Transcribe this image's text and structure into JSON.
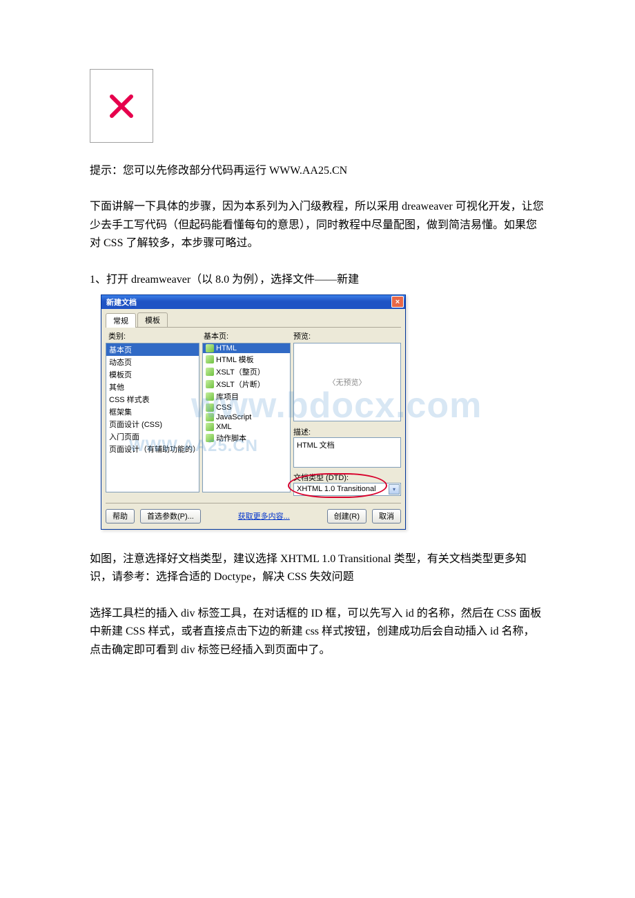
{
  "tip_text": "提示：您可以先修改部分代码再运行 WWW.AA25.CN",
  "intro_text": "下面讲解一下具体的步骤，因为本系列为入门级教程，所以采用 dreaweaver 可视化开发，让您少去手工写代码（但起码能看懂每句的意思），同时教程中尽量配图，做到简洁易懂。如果您对 CSS 了解较多，本步骤可略过。",
  "step1_text": "1、打开 dreamweaver（以 8.0 为例），选择文件——新建",
  "after_dialog_p1": "如图，注意选择好文档类型，建议选择 XHTML 1.0 Transitional 类型，有关文档类型更多知识，请参考：选择合适的 Doctype，解决 CSS 失效问题",
  "after_dialog_p2": "选择工具栏的插入 div 标签工具，在对话框的 ID 框，可以先写入 id 的名称，然后在 CSS 面板中新建 CSS 样式，或者直接点击下边的新建 css 样式按钮，创建成功后会自动插入 id 名称，点击确定即可看到 div 标签已经插入到页面中了。",
  "dialog": {
    "title": "新建文档",
    "tabs": {
      "t1": "常规",
      "t2": "模板"
    },
    "col_labels": {
      "c1": "类别:",
      "c2": "基本页:",
      "c3": "预览:"
    },
    "categories": [
      "基本页",
      "动态页",
      "模板页",
      "其他",
      "CSS 样式表",
      "框架集",
      "页面设计 (CSS)",
      "入门页面",
      "页面设计（有辅助功能的）"
    ],
    "basic_pages": [
      "HTML",
      "HTML 模板",
      "XSLT（整页）",
      "XSLT（片断）",
      "库项目",
      "CSS",
      "JavaScript",
      "XML",
      "动作脚本"
    ],
    "no_preview": "〈无预览〉",
    "desc_label": "描述:",
    "desc_value": "HTML 文档",
    "dtd_label": "文档类型 (DTD):",
    "dtd_value": "XHTML 1.0 Transitional",
    "btn_help": "帮助",
    "btn_prefs": "首选参数(P)...",
    "link_more": "获取更多内容...",
    "btn_create": "创建(R)",
    "btn_cancel": "取消",
    "watermark_big": "www.bdocx.com",
    "watermark_small": "WWW.AA25.CN"
  }
}
